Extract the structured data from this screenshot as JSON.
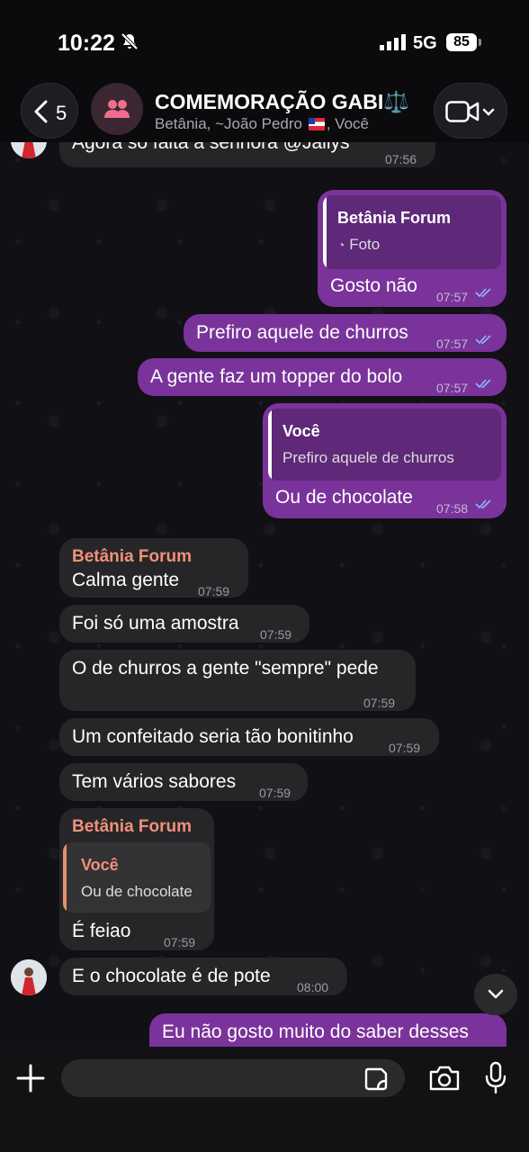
{
  "status": {
    "time": "10:22",
    "network": "5G",
    "battery": "85"
  },
  "header": {
    "back_count": "5",
    "title": "COMEMORAÇÃO GABI⚖️",
    "subtitle_part1": "Betânia, ~João Pedro",
    "subtitle_part2": ", Você"
  },
  "messages": [
    {
      "text": "Agora só falta a senhora @Jailys",
      "time": "07:56"
    },
    {
      "quote_name": "Betânia Forum",
      "quote_text": "Foto",
      "text": "Gosto não",
      "time": "07:57"
    },
    {
      "text": "Prefiro aquele de churros",
      "time": "07:57"
    },
    {
      "text": "A gente faz um topper do bolo",
      "time": "07:57"
    },
    {
      "quote_name": "Você",
      "quote_text": "Prefiro aquele de churros",
      "text": "Ou de chocolate",
      "time": "07:58"
    },
    {
      "sender": "Betânia Forum",
      "text": "Calma gente",
      "time": "07:59"
    },
    {
      "text": "Foi só uma amostra",
      "time": "07:59"
    },
    {
      "text": "O de churros a gente \"sempre\" pede",
      "time": "07:59"
    },
    {
      "text": "Um confeitado seria tão bonitinho",
      "time": "07:59"
    },
    {
      "text": "Tem vários sabores",
      "time": "07:59"
    },
    {
      "sender": "Betânia Forum",
      "quote_name": "Você",
      "quote_text": "Ou de chocolate",
      "text": "É feiao",
      "time": "07:59"
    },
    {
      "text": "E o chocolate é de pote",
      "time": "08:00"
    },
    {
      "text": "Eu não gosto muito do saber desses"
    }
  ],
  "composer": {
    "placeholder": ""
  },
  "colors": {
    "outgoing": "#7a339a",
    "incoming": "#262628",
    "sender_name": "#f0907a",
    "read_ticks": "#8fb8ff"
  }
}
